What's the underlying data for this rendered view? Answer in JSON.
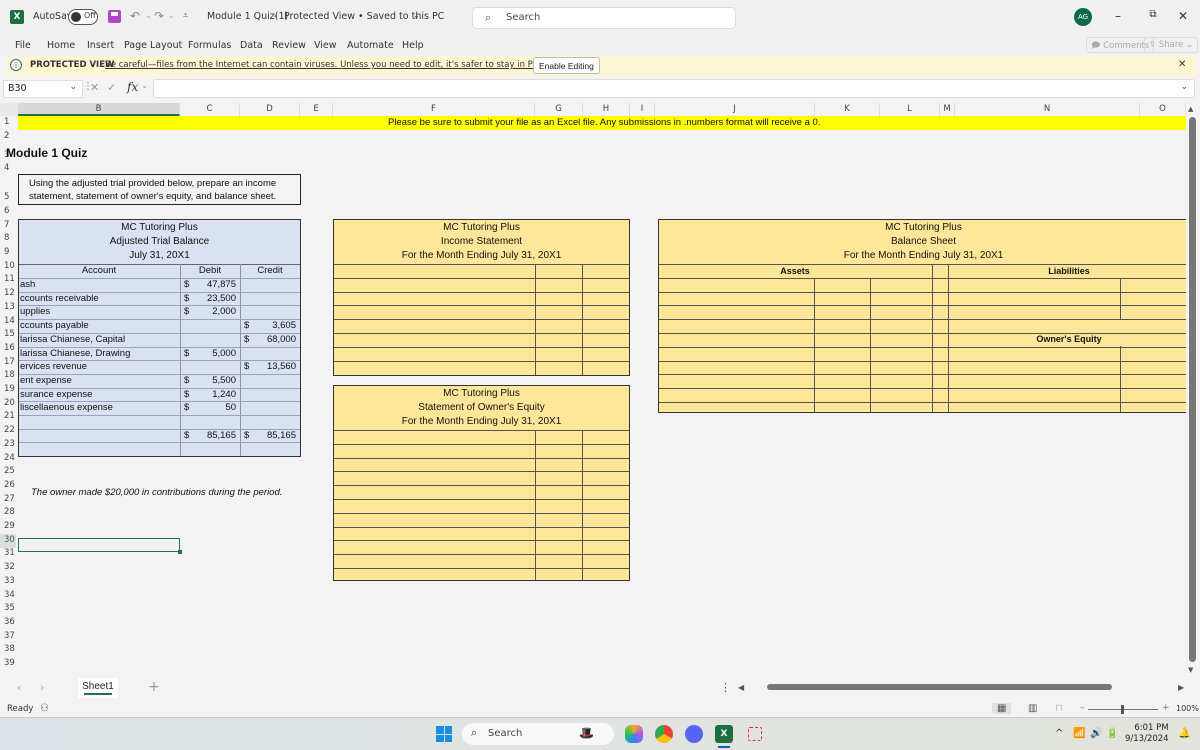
{
  "titlebar": {
    "autosave_label": "AutoSave",
    "autosave_state": "Off",
    "doc_title": "Module 1 Quiz(1)",
    "separator": "-",
    "doc_status": "Protected View • Saved to this PC",
    "search_placeholder": "Search",
    "avatar_initials": "AG"
  },
  "ribbon": {
    "tabs": [
      "File",
      "Home",
      "Insert",
      "Page Layout",
      "Formulas",
      "Data",
      "Review",
      "View",
      "Automate",
      "Help"
    ],
    "comments_label": "Comments",
    "share_label": "Share"
  },
  "protected_view": {
    "title": "PROTECTED VIEW",
    "message": "Be careful—files from the Internet can contain viruses. Unless you need to edit, it's safer to stay in Protected View.",
    "enable_button": "Enable Editing"
  },
  "formula_bar": {
    "name_box": "B30",
    "fx_label": "fx",
    "formula": ""
  },
  "grid": {
    "columns": [
      "B",
      "C",
      "D",
      "E",
      "F",
      "G",
      "H",
      "I",
      "J",
      "K",
      "L",
      "M",
      "N",
      "O"
    ],
    "selected_column": "B",
    "rows": [
      "1",
      "2",
      "3",
      "4",
      "5",
      "6",
      "7",
      "8",
      "9",
      "10",
      "11",
      "12",
      "13",
      "14",
      "15",
      "16",
      "17",
      "18",
      "19",
      "20",
      "21",
      "22",
      "23",
      "24",
      "25",
      "26",
      "27",
      "28",
      "29",
      "30",
      "31",
      "32",
      "33",
      "34",
      "35",
      "36",
      "37",
      "38",
      "39"
    ],
    "selected_row": "30",
    "banner_text": "Please be sure to submit your file as an Excel file. Any submissions in .numbers format will receive a 0.",
    "quiz_title": "Module 1 Quiz",
    "instructions_line1": "Using the adjusted trial provided below, prepare an income",
    "instructions_line2": "statement, statement of owner's equity, and balance sheet.",
    "note": "The owner made $20,000 in contributions during the period."
  },
  "trial_balance": {
    "company": "MC Tutoring Plus",
    "title": "Adjusted Trial Balance",
    "date": "July 31, 20X1",
    "headers": {
      "account": "Account",
      "debit": "Debit",
      "credit": "Credit"
    },
    "rows": [
      {
        "account": "ash",
        "debit": "47,875",
        "credit": ""
      },
      {
        "account": "ccounts receivable",
        "debit": "23,500",
        "credit": ""
      },
      {
        "account": "upplies",
        "debit": "2,000",
        "credit": ""
      },
      {
        "account": "ccounts payable",
        "debit": "",
        "credit": "3,605"
      },
      {
        "account": "larissa Chianese, Capital",
        "debit": "",
        "credit": "68,000"
      },
      {
        "account": "larissa Chianese, Drawing",
        "debit": "5,000",
        "credit": ""
      },
      {
        "account": "ervices revenue",
        "debit": "",
        "credit": "13,560"
      },
      {
        "account": "ent expense",
        "debit": "5,500",
        "credit": ""
      },
      {
        "account": "surance expense",
        "debit": "1,240",
        "credit": ""
      },
      {
        "account": "liscellaenous expense",
        "debit": "50",
        "credit": ""
      },
      {
        "account": "",
        "debit": "",
        "credit": ""
      },
      {
        "account": "",
        "debit": "85,165",
        "credit": "85,165"
      },
      {
        "account": "",
        "debit": "",
        "credit": ""
      }
    ],
    "currency_symbol": "$"
  },
  "income_statement": {
    "company": "MC Tutoring Plus",
    "title": "Income Statement",
    "period": "For the Month Ending July 31, 20X1"
  },
  "owners_equity_statement": {
    "company": "MC Tutoring Plus",
    "title": "Statement of Owner's Equity",
    "period": "For the Month Ending July 31, 20X1"
  },
  "balance_sheet": {
    "company": "MC Tutoring Plus",
    "title": "Balance Sheet",
    "period": "For the Month Ending July 31, 20X1",
    "assets_label": "Assets",
    "liabilities_label": "Liabilities",
    "equity_label": "Owner's Equity"
  },
  "sheets": {
    "tabs": [
      "Sheet1"
    ],
    "active": "Sheet1"
  },
  "statusbar": {
    "status": "Ready",
    "zoom": "100%"
  },
  "taskbar": {
    "search_placeholder": "Search",
    "time": "6:01 PM",
    "date": "9/13/2024"
  }
}
